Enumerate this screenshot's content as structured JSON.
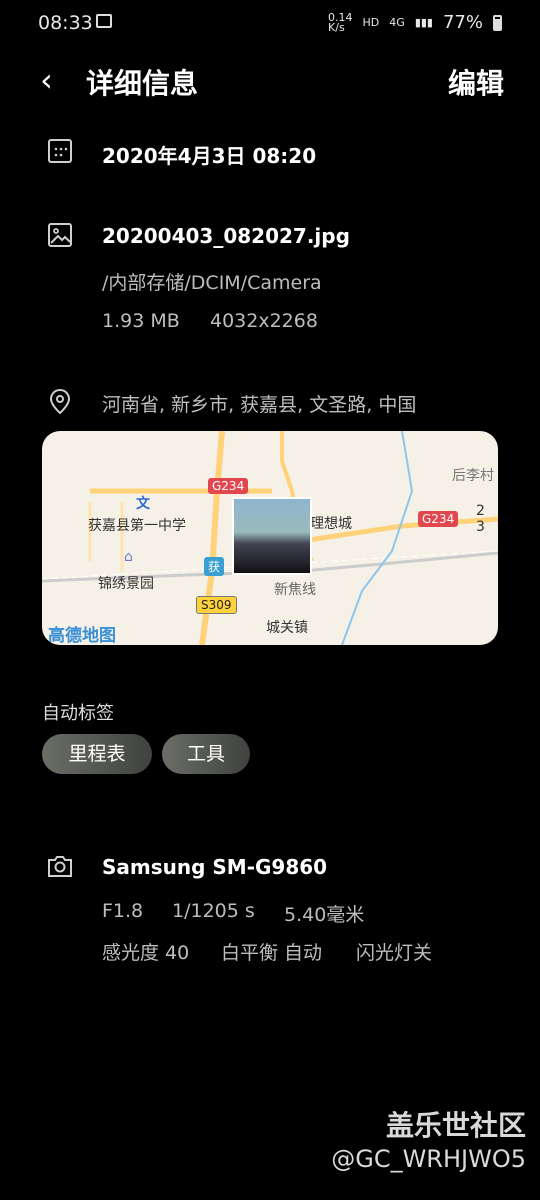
{
  "statusbar": {
    "time": "08:33",
    "net_speed": "0.14\nK/s",
    "hd": "HD",
    "signal": "4G",
    "battery": "77%"
  },
  "header": {
    "title": "详细信息",
    "edit": "编辑"
  },
  "date": {
    "text": "2020年4月3日 08:20"
  },
  "file": {
    "name": "20200403_082027.jpg",
    "path": "/内部存储/DCIM/Camera",
    "size": "1.93 MB",
    "resolution": "4032x2268"
  },
  "location": {
    "address": "河南省, 新乡市, 获嘉县, 文圣路, 中国"
  },
  "map": {
    "labels": {
      "houli": "后李村",
      "g234_top": "G234",
      "g234_right": "G234",
      "school": "获嘉县第一中学",
      "wen": "文",
      "lixiang": "理想城",
      "jinxiu": "锦绣景园",
      "huo": "获",
      "s309": "S309",
      "xinjiao": "新焦线",
      "chengguan": "城关镇",
      "gaode": "高德地图",
      "small": "2 3"
    }
  },
  "tags": {
    "title": "自动标签",
    "items": [
      "里程表",
      "工具"
    ]
  },
  "camera": {
    "model": "Samsung SM-G9860",
    "aperture": "F1.8",
    "shutter": "1/1205 s",
    "focal": "5.40毫米",
    "iso": "感光度 40",
    "wb": "白平衡 自动",
    "flash": "闪光灯关"
  },
  "watermark": {
    "line1": "盖乐世社区",
    "line2": "@GC_WRHJWO5"
  }
}
